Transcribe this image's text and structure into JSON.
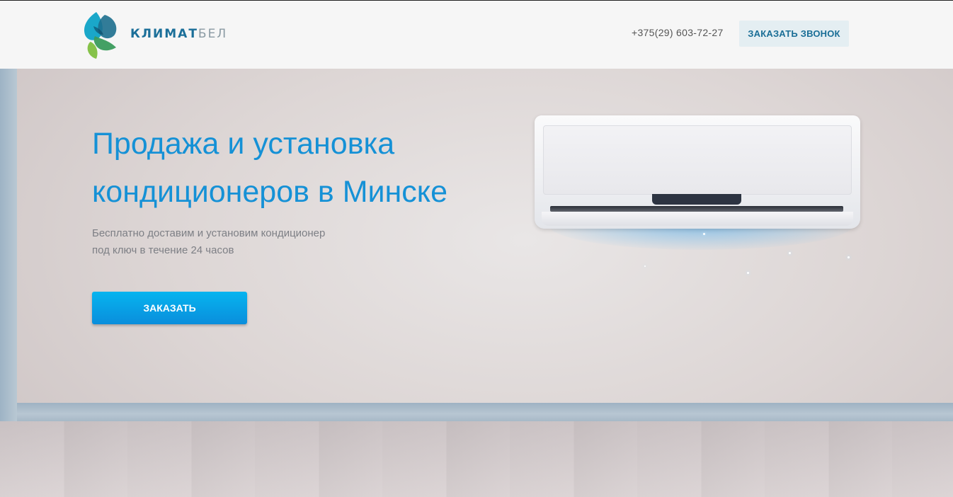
{
  "header": {
    "logo_text_part1": "КЛИМАТ",
    "logo_text_part2": "БЕЛ",
    "phone": "+375(29) 603-72-27",
    "call_button_label": "ЗАКАЗАТЬ ЗВОНОК"
  },
  "hero": {
    "title_lines": [
      "Продажа и установка",
      "кондиционеров в Минске"
    ],
    "subtitle_lines": [
      "Бесплатно доставим и установим кондиционер",
      "под ключ в течение 24 часов"
    ],
    "order_button_label": "ЗАКАЗАТЬ"
  },
  "colors": {
    "accent": "#1591d6",
    "button_gradient_top": "#06b4ef",
    "button_gradient_bottom": "#0a8edc",
    "call_button_bg": "#e4eef2"
  },
  "icons": [
    "logo-leaf-icon"
  ]
}
